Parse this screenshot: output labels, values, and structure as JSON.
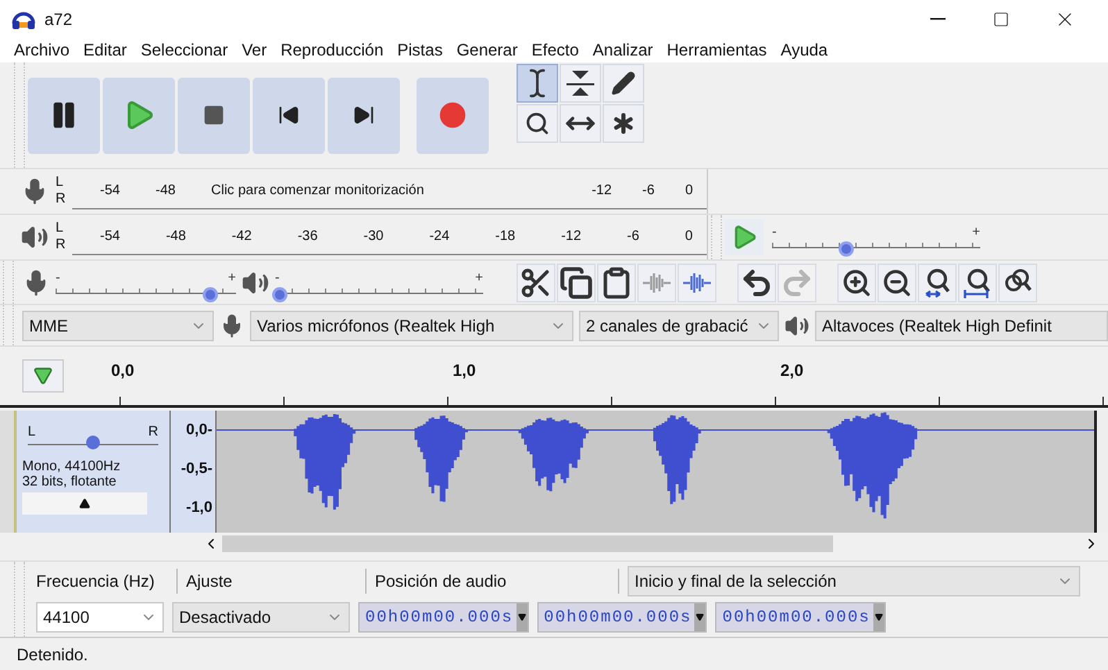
{
  "window": {
    "title": "a72"
  },
  "menu": [
    "Archivo",
    "Editar",
    "Seleccionar",
    "Ver",
    "Reproducción",
    "Pistas",
    "Generar",
    "Efecto",
    "Analizar",
    "Herramientas",
    "Ayuda"
  ],
  "transport": [
    {
      "kind": "pause"
    },
    {
      "kind": "play"
    },
    {
      "kind": "stop"
    },
    {
      "kind": "start"
    },
    {
      "kind": "end"
    },
    {
      "kind": "record"
    }
  ],
  "tools": [
    {
      "kind": "select",
      "selected": true
    },
    {
      "kind": "envelope",
      "selected": false
    },
    {
      "kind": "draw",
      "selected": false
    },
    {
      "kind": "zoom",
      "selected": false
    },
    {
      "kind": "timeshift",
      "selected": false
    },
    {
      "kind": "multi",
      "selected": false
    }
  ],
  "record_meter": {
    "left": "L",
    "right": "R",
    "ticks": [
      "-54",
      "-48"
    ],
    "message": "Clic para comenzar monitorización",
    "ticks_end": [
      "-12",
      "-6",
      "0"
    ]
  },
  "play_meter": {
    "left": "L",
    "right": "R",
    "ticks": [
      "-54",
      "-48",
      "-42",
      "-36",
      "-30",
      "-24",
      "-18",
      "-12",
      "-6",
      "0"
    ]
  },
  "play_at_speed": {
    "minus": "-",
    "plus": "+",
    "level": 0.35
  },
  "mixer": {
    "recording": {
      "minus": "-",
      "plus": "+",
      "level": 0.85
    },
    "playback": {
      "minus": "-",
      "plus": "+",
      "level": 0.02
    }
  },
  "edit_buttons": [
    {
      "kind": "cut",
      "disabled": false
    },
    {
      "kind": "copy",
      "disabled": false
    },
    {
      "kind": "paste",
      "disabled": false
    },
    {
      "kind": "trim",
      "disabled": false
    },
    {
      "kind": "silence",
      "disabled": false
    },
    {
      "kind": "undo",
      "disabled": false
    },
    {
      "kind": "redo",
      "disabled": true
    },
    {
      "kind": "zoom-in",
      "disabled": false
    },
    {
      "kind": "zoom-out",
      "disabled": false
    },
    {
      "kind": "fit-selection",
      "disabled": false
    },
    {
      "kind": "fit-project",
      "disabled": false
    },
    {
      "kind": "zoom-toggle",
      "disabled": false
    }
  ],
  "devices": {
    "host": "MME",
    "input": "Varios micrófonos (Realtek High",
    "channels": "2 canales de grabacić",
    "output": "Altavoces (Realtek High Definit"
  },
  "timeline": {
    "labels": [
      "0,0",
      "1,0",
      "2,0"
    ]
  },
  "track": {
    "pan": {
      "left": "L",
      "right": "R",
      "level": 0.5
    },
    "info": [
      "Mono, 44100Hz",
      "32 bits, flotante"
    ],
    "scale": [
      "0,0-",
      "-0,5-",
      "-1,0"
    ]
  },
  "selection_toolbar": {
    "rate_label": "Frecuencia (Hz)",
    "rate": "44100",
    "snap_label": "Ajuste",
    "snap": "Desactivado",
    "position_label": "Posición de audio",
    "position": "00h00m00.000s",
    "selection_mode": "Inicio y final de la selección",
    "selection_start": "00h00m00.000s",
    "selection_end": "00h00m00.000s"
  },
  "status_bar": {
    "text": "Detenido."
  }
}
